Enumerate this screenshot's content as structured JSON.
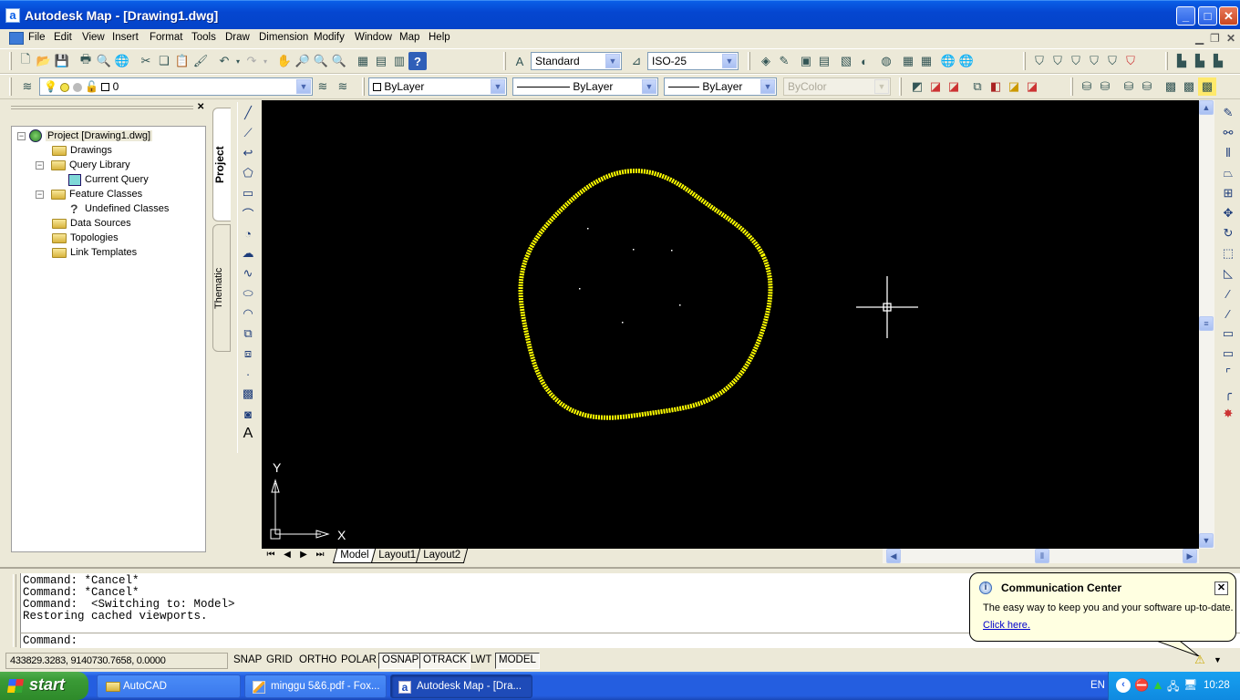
{
  "window": {
    "title": "Autodesk Map - [Drawing1.dwg]",
    "app_icon_letter": "a"
  },
  "menu": {
    "items": [
      "File",
      "Edit",
      "View",
      "Insert",
      "Format",
      "Tools",
      "Draw",
      "Dimension",
      "Modify",
      "Window",
      "Map",
      "Help"
    ]
  },
  "toolbar_standard": {
    "text_style": "Standard",
    "dim_style": "ISO-25"
  },
  "toolbar_layers": {
    "layer": "0",
    "color": "ByLayer",
    "linetype": "ByLayer",
    "lineweight": "ByLayer",
    "plotstyle": "ByColor"
  },
  "project_panel": {
    "tree": [
      {
        "label": "Project [Drawing1.dwg]",
        "level": 0,
        "icon": "globe-icon",
        "expanded": true
      },
      {
        "label": "Drawings",
        "level": 1,
        "icon": "folder-icon"
      },
      {
        "label": "Query Library",
        "level": 1,
        "icon": "folder-icon",
        "expanded": true
      },
      {
        "label": "Current Query",
        "level": 2,
        "icon": "query-icon"
      },
      {
        "label": "Feature Classes",
        "level": 1,
        "icon": "folder-icon",
        "expanded": true
      },
      {
        "label": "Undefined Classes",
        "level": 2,
        "icon": "question-icon"
      },
      {
        "label": "Data Sources",
        "level": 1,
        "icon": "folder-icon"
      },
      {
        "label": "Topologies",
        "level": 1,
        "icon": "folder-icon"
      },
      {
        "label": "Link Templates",
        "level": 1,
        "icon": "folder-icon"
      }
    ],
    "tabs": [
      "Project",
      "Thematic"
    ]
  },
  "canvas": {
    "ucs_x": "X",
    "ucs_y": "Y",
    "drawing_color": "#ffff00",
    "background": "#000000"
  },
  "layout_tabs": [
    "Model",
    "Layout1",
    "Layout2"
  ],
  "command": {
    "history": [
      "Command: *Cancel*",
      "Command: *Cancel*",
      "Command:  <Switching to: Model>",
      "Restoring cached viewports."
    ],
    "prompt": "Command:"
  },
  "status": {
    "coordinates": "433829.3283, 9140730.7658, 0.0000",
    "toggles": [
      {
        "label": "SNAP",
        "on": false
      },
      {
        "label": "GRID",
        "on": false
      },
      {
        "label": "ORTHO",
        "on": false
      },
      {
        "label": "POLAR",
        "on": false
      },
      {
        "label": "OSNAP",
        "on": true
      },
      {
        "label": "OTRACK",
        "on": true
      },
      {
        "label": "LWT",
        "on": false
      },
      {
        "label": "MODEL",
        "on": true
      }
    ]
  },
  "balloon": {
    "title": "Communication Center",
    "message": "The easy way to keep you and your software up-to-date.",
    "link": "Click here."
  },
  "taskbar": {
    "start": "start",
    "tasks": [
      {
        "label": "AutoCAD",
        "icon": "folder-icon",
        "active": false
      },
      {
        "label": "minggu 5&6.pdf - Fox...",
        "icon": "pdf-icon",
        "active": false
      },
      {
        "label": "Autodesk Map - [Dra...",
        "icon": "autodesk-icon",
        "active": true
      }
    ],
    "language": "EN",
    "clock": "10:28"
  }
}
